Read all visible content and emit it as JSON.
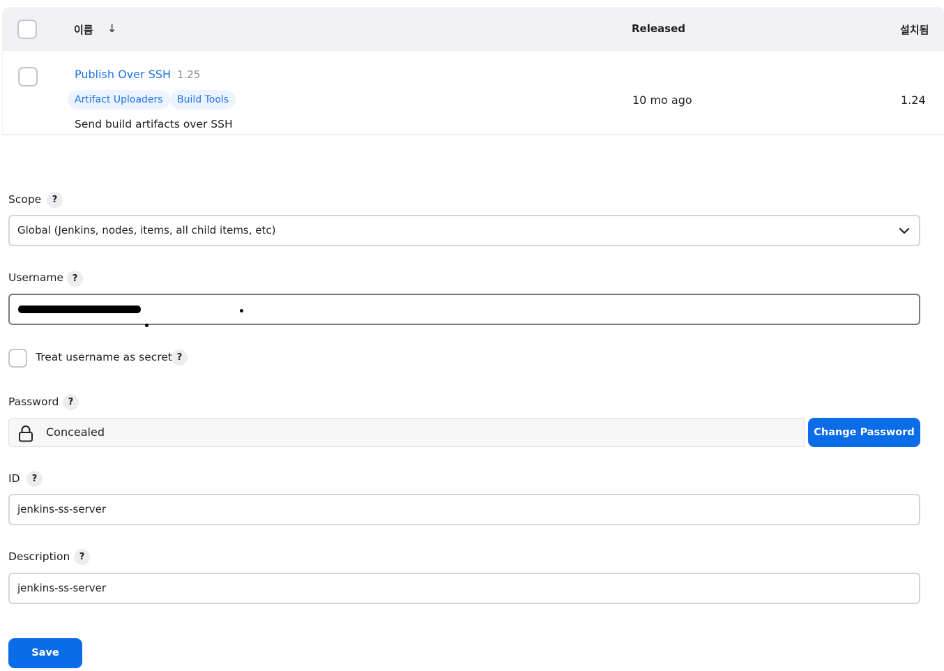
{
  "plugin_table": {
    "header": {
      "name_label": "이름",
      "sort_arrow": "↓",
      "released_label": "Released",
      "installed_label": "설치됨"
    },
    "rows": [
      {
        "name": "Publish Over SSH",
        "version": "1.25",
        "tags": [
          "Artifact Uploaders",
          "Build Tools"
        ],
        "description": "Send build artifacts over SSH",
        "released": "10 mo ago",
        "installed": "1.24",
        "selected": false
      }
    ]
  },
  "form": {
    "scope": {
      "label": "Scope",
      "help": "?",
      "value": "Global (Jenkins, nodes, items, all child items, etc)"
    },
    "username": {
      "label": "Username",
      "help": "?",
      "redacted": true
    },
    "treat_secret": {
      "label": "Treat username as secret",
      "help": "?",
      "checked": false
    },
    "password": {
      "label": "Password",
      "help": "?",
      "status": "Concealed",
      "change_button": "Change Password"
    },
    "id": {
      "label": "ID",
      "help": "?",
      "value": "jenkins-ss-server"
    },
    "description": {
      "label": "Description",
      "help": "?",
      "value": "jenkins-ss-server"
    },
    "save_button": "Save"
  },
  "colors": {
    "accent": "#0b6ce8",
    "link": "#1a73e8",
    "tag_bg": "#eef4ff",
    "header_bg": "#f2f2f5"
  },
  "icons": {
    "dropdown": "chevron-down-icon",
    "password": "lock-icon",
    "help": "question-mark-icon"
  }
}
